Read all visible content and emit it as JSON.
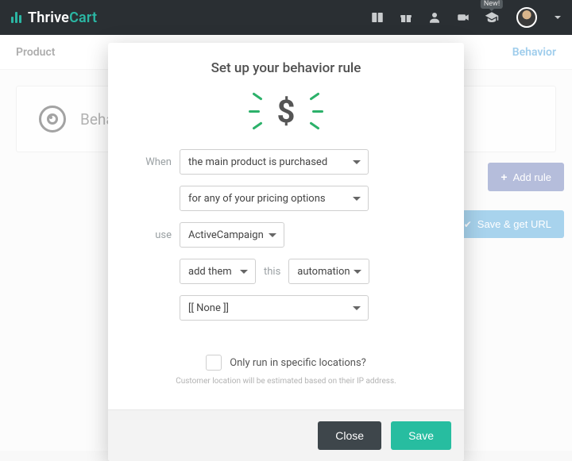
{
  "brand": {
    "name_prefix": "Thrive",
    "name_suffix": "Cart"
  },
  "topbar": {
    "new_badge": "New!"
  },
  "tabs": {
    "product": "Product",
    "behavior": "Behavior"
  },
  "panel": {
    "title": "Behavior rules"
  },
  "side": {
    "add_rule": "Add rule",
    "save_url": "Save & get URL"
  },
  "modal": {
    "title": "Set up your behavior rule",
    "labels": {
      "when": "When",
      "use": "use",
      "this": "this"
    },
    "selects": {
      "trigger": "the main product is purchased",
      "pricing": "for any of your pricing options",
      "service": "ActiveCampaign",
      "action": "add them",
      "target_type": "automation",
      "target": "[[ None ]]"
    },
    "location": {
      "checkbox_label": "Only run in specific locations?",
      "hint": "Customer location will be estimated based on their IP address."
    },
    "buttons": {
      "close": "Close",
      "save": "Save"
    }
  }
}
